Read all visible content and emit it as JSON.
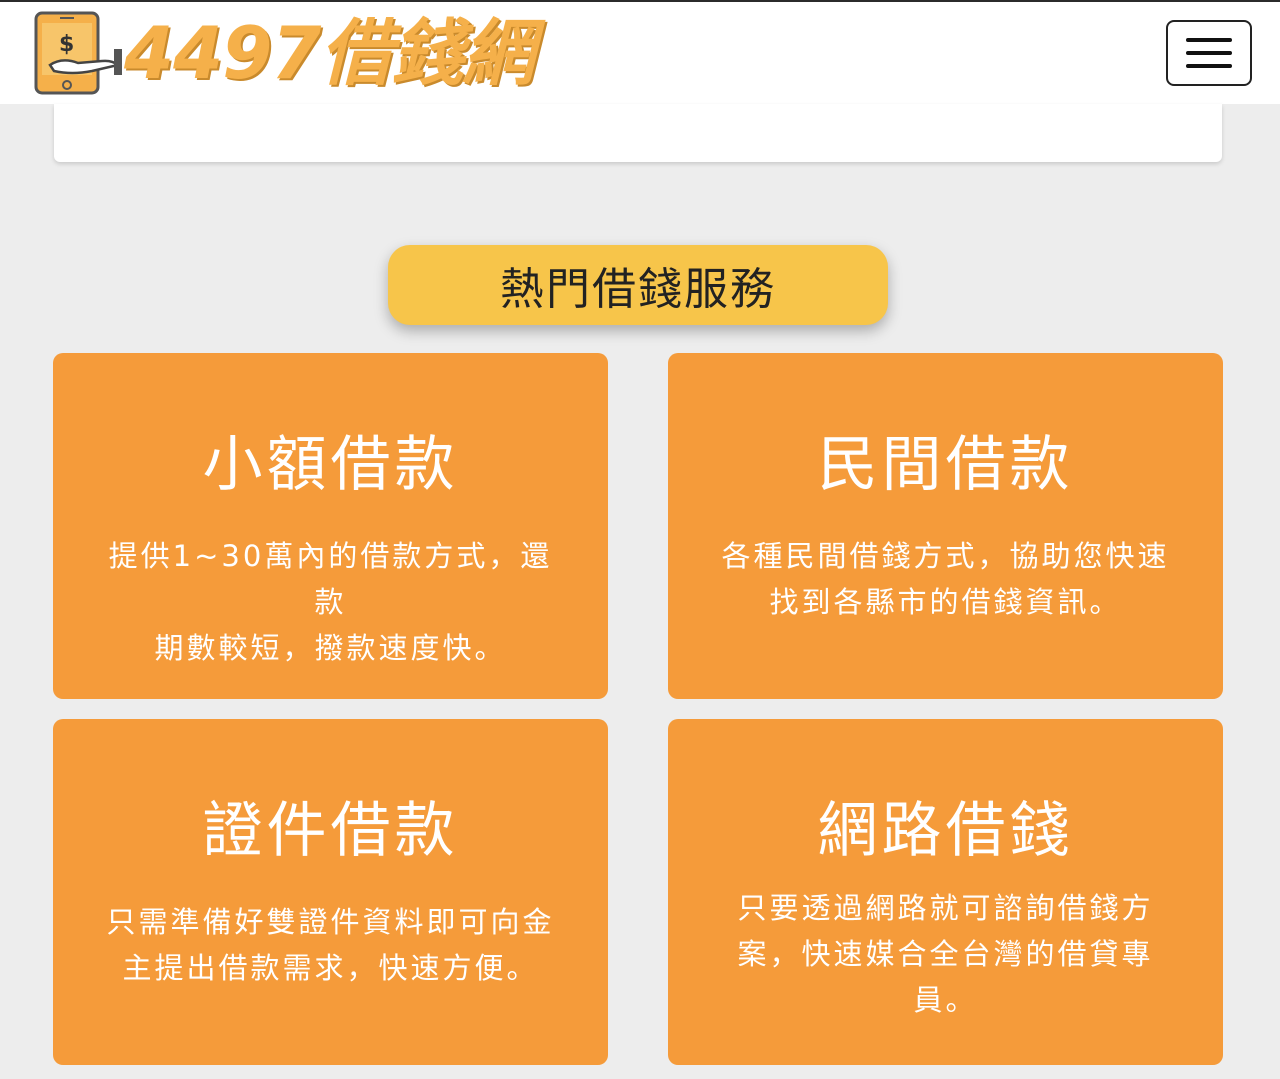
{
  "header": {
    "logo_text": "4497借錢網",
    "logo_icon": "money-hand-phone-icon",
    "menu_icon": "hamburger-menu-icon"
  },
  "colors": {
    "accent_orange": "#f59b3a",
    "pill_yellow": "#f7c54a",
    "logo_gold": "#f5b04a",
    "background": "#ededed"
  },
  "section": {
    "title": "熱門借錢服務"
  },
  "services": [
    {
      "title": "小額借款",
      "desc_line1": "提供1~30萬內的借款方式，還款",
      "desc_line2": "期數較短，撥款速度快。"
    },
    {
      "title": "民間借款",
      "desc_line1": "各種民間借錢方式，協助您快速",
      "desc_line2": "找到各縣市的借錢資訊。"
    },
    {
      "title": "證件借款",
      "desc_line1": "只需準備好雙證件資料即可向金",
      "desc_line2": "主提出借款需求，快速方便。"
    },
    {
      "title": "網路借錢",
      "desc_line1": "只要透過網路就可諮詢借錢方",
      "desc_line2": "案，快速媒合全台灣的借貸專",
      "desc_line3": "員。"
    }
  ]
}
